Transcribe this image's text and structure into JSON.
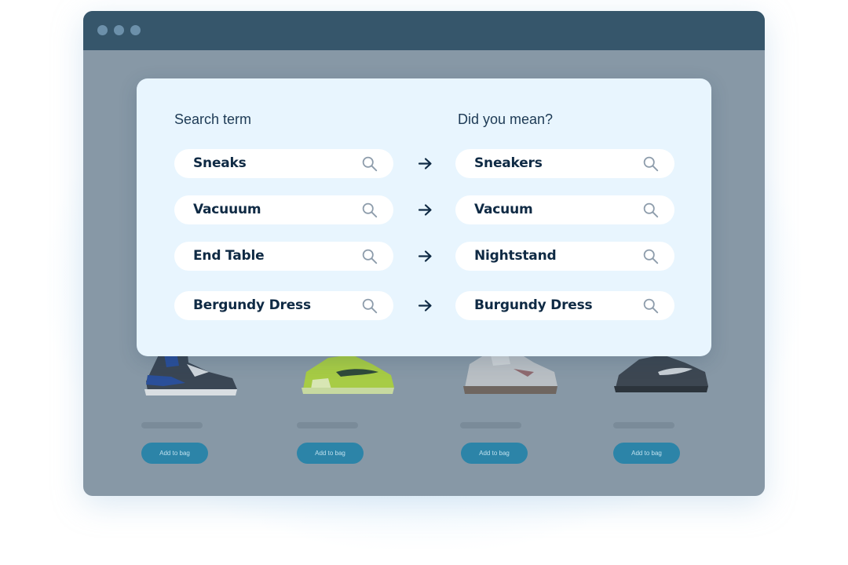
{
  "modal": {
    "left_heading": "Search term",
    "right_heading": "Did you mean?",
    "rows": [
      {
        "search": "Sneaks",
        "suggestion": "Sneakers"
      },
      {
        "search": "Vacuuum",
        "suggestion": "Vacuum"
      },
      {
        "search": "End Table",
        "suggestion": "Nightstand"
      },
      {
        "search": "Bergundy Dress",
        "suggestion": "Burgundy Dress"
      }
    ]
  },
  "products": [
    {
      "button_label": "Add to bag",
      "shoe_color": "#2a4f9a"
    },
    {
      "button_label": "Add to bag",
      "shoe_color": "#a7cc45"
    },
    {
      "button_label": "Add to bag",
      "shoe_color": "#b9bfc4"
    },
    {
      "button_label": "Add to bag",
      "shoe_color": "#3d4752"
    }
  ],
  "colors": {
    "titlebar": "#36566b",
    "backdrop": "#8798a6",
    "modal_bg": "#e8f5fe",
    "text_dark": "#0f2a44",
    "button": "#2c84a8"
  },
  "icons": {
    "search": "search-icon",
    "arrow": "arrow-right-icon"
  }
}
